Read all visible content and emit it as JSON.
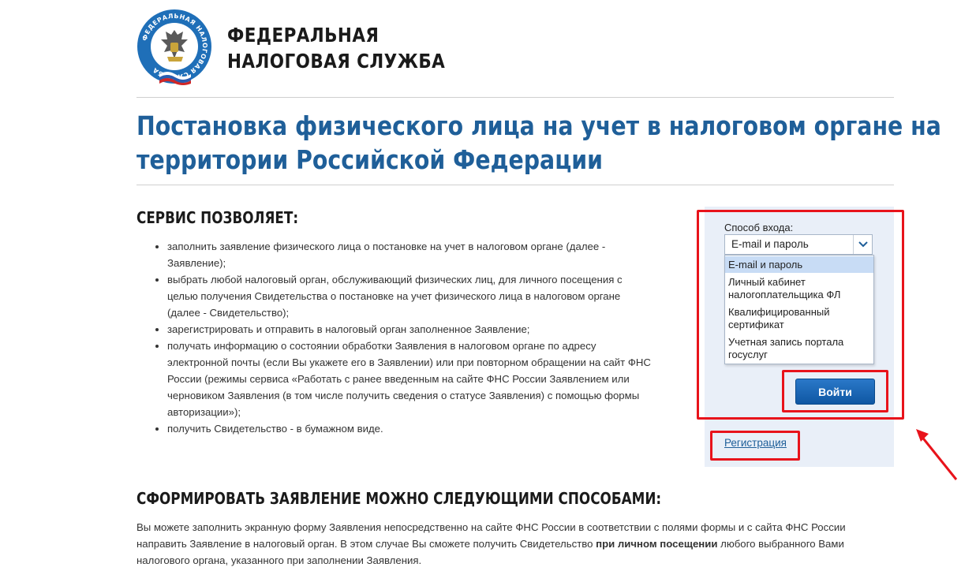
{
  "header": {
    "org_line1": "ФЕДЕРАЛЬНАЯ",
    "org_line2": "НАЛОГОВАЯ СЛУЖБА",
    "logo_ring_text": "ФЕДЕРАЛЬНАЯ НАЛОГОВАЯ СЛУЖБА"
  },
  "page": {
    "title_line1": "Постановка физического лица на учет в налоговом органе на",
    "title_line2": "территории Российской Федерации"
  },
  "service": {
    "heading": "СЕРВИС ПОЗВОЛЯЕТ:",
    "items": [
      [
        "заполнить заявление физического лица о постановке на учет в налоговом органе (далее -",
        "Заявление);"
      ],
      [
        "выбрать любой налоговый орган, обслуживающий физических лиц, для личного посещения с",
        "целью получения Свидетельства о постановке на учет физического лица в налоговом органе",
        "(далее - Свидетельство);"
      ],
      [
        "зарегистрировать и отправить в налоговый орган заполненное Заявление;"
      ],
      [
        "получать информацию о состоянии обработки Заявления в налоговом органе по адресу",
        "электронной почты (если Вы укажете его в Заявлении) или при повторном обращении на сайт ФНС",
        "России (режимы сервиса «Работать с ранее введенным на сайте ФНС России Заявлением или",
        "черновиком Заявления (в том числе получить сведения о статусе Заявления) с помощью формы",
        "авторизации»);"
      ],
      [
        "получить Свидетельство - в бумажном виде."
      ]
    ]
  },
  "login": {
    "method_label": "Способ входа:",
    "selected_value": "E-mail и пароль",
    "options": [
      [
        "E-mail и пароль"
      ],
      [
        "Личный кабинет",
        "налогоплательщика ФЛ"
      ],
      [
        "Квалифицированный",
        "сертификат"
      ],
      [
        "Учетная запись портала",
        "госуслуг"
      ]
    ],
    "submit_label": "Войти",
    "register_link": "Регистрация"
  },
  "methods": {
    "heading": "СФОРМИРОВАТЬ ЗАЯВЛЕНИЕ МОЖНО СЛЕДУЮЩИМИ СПОСОБАМИ:",
    "para_line1": "Вы можете заполнить экранную форму Заявления непосредственно на сайте ФНС России в соответствии с полями формы и с сайта ФНС России",
    "para_line2_a": "направить Заявление в налоговый орган. В этом случае Вы сможете получить Свидетельство ",
    "para_line2_bold": "при личном посещении",
    "para_line2_b": " любого выбранного Вами",
    "para_line3": "налогового органа, указанного при заполнении Заявления."
  },
  "colors": {
    "brand_blue": "#1f5f99",
    "annotation_red": "#e8131b",
    "panel_bg": "#e9eff8"
  }
}
